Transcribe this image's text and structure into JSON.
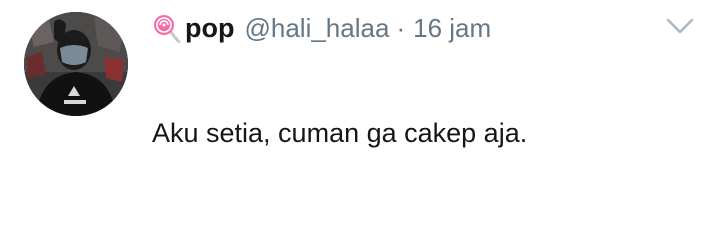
{
  "tweet": {
    "display_name": "pop",
    "name_emoji": "lollipop-icon",
    "handle": "@hali_halaa",
    "separator": "·",
    "timestamp": "16 jam",
    "text": "Aku setia, cuman ga cakep aja.",
    "menu_icon": "chevron-down-icon"
  },
  "colors": {
    "text_primary": "#14171a",
    "text_secondary": "#657786",
    "chevron": "#aab8c2"
  }
}
